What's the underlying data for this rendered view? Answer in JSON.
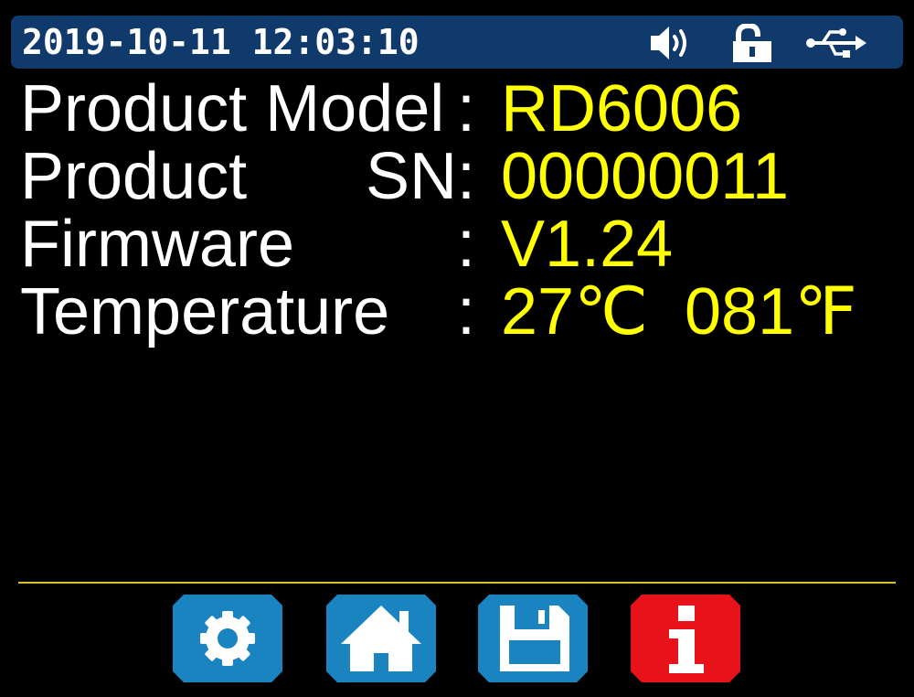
{
  "status_bar": {
    "date": "2019-10-11",
    "time": "12:03:10",
    "datetime_text": "2019-10-11 12:03:10",
    "icons": [
      "speaker-icon",
      "unlocked-padlock-icon",
      "usb-icon"
    ],
    "background_color": "#0f3a6b"
  },
  "info": {
    "model": {
      "label": "Product Model",
      "colon": ":",
      "value": "RD6006"
    },
    "sn": {
      "label": "Product",
      "key": "SN",
      "colon": ":",
      "value": "00000011"
    },
    "firmware": {
      "label": "Firmware",
      "colon": ":",
      "value": "V1.24"
    },
    "temperature": {
      "label": "Temperature",
      "colon": ":",
      "value": "27℃  081℉"
    }
  },
  "colors": {
    "label": "#ffffff",
    "value": "#ffff00",
    "divider": "#d8c02a",
    "nav_button": "#1a84c0",
    "info_button": "#e8121b"
  },
  "nav": {
    "buttons": [
      {
        "name": "settings",
        "icon": "gear-icon"
      },
      {
        "name": "home",
        "icon": "home-icon"
      },
      {
        "name": "save",
        "icon": "floppy-disk-icon"
      },
      {
        "name": "info",
        "icon": "info-icon",
        "active": true
      }
    ]
  }
}
